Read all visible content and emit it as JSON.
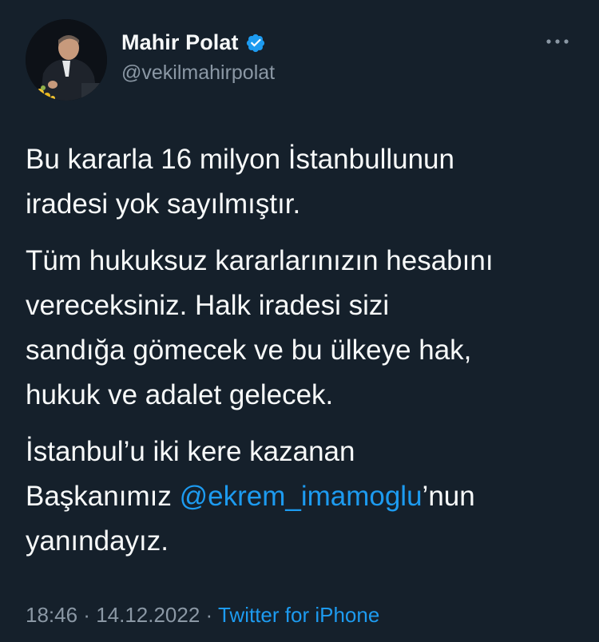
{
  "author": {
    "display_name": "Mahir Polat",
    "handle": "@vekilmahirpolat",
    "verified": true
  },
  "icons": {
    "avatar": "profile-photo",
    "verified": "verified-badge-icon",
    "more": "more-options-icon"
  },
  "tweet": {
    "paragraphs": [
      [
        "Bu kararla 16 milyon İstanbullunun",
        "iradesi yok sayılmıştır."
      ],
      [
        "Tüm hukuksuz kararlarınızın hesabını",
        "vereceksiniz. Halk iradesi sizi",
        "sandığa gömecek ve bu ülkeye hak,",
        "hukuk ve adalet gelecek."
      ],
      [
        "İstanbul’u iki kere kazanan"
      ]
    ],
    "p3_line2_before": "Başkanımız ",
    "mention": "@ekrem_imamoglu",
    "p3_line2_after": "’nun",
    "p3_line3": "yanındayız."
  },
  "meta": {
    "time": "18:46",
    "separator": " · ",
    "date": "14.12.2022",
    "source": "Twitter for iPhone"
  },
  "colors": {
    "background": "#15202b",
    "text": "#f7f9f9",
    "secondary": "#8b98a5",
    "accent": "#1d9bf0"
  }
}
